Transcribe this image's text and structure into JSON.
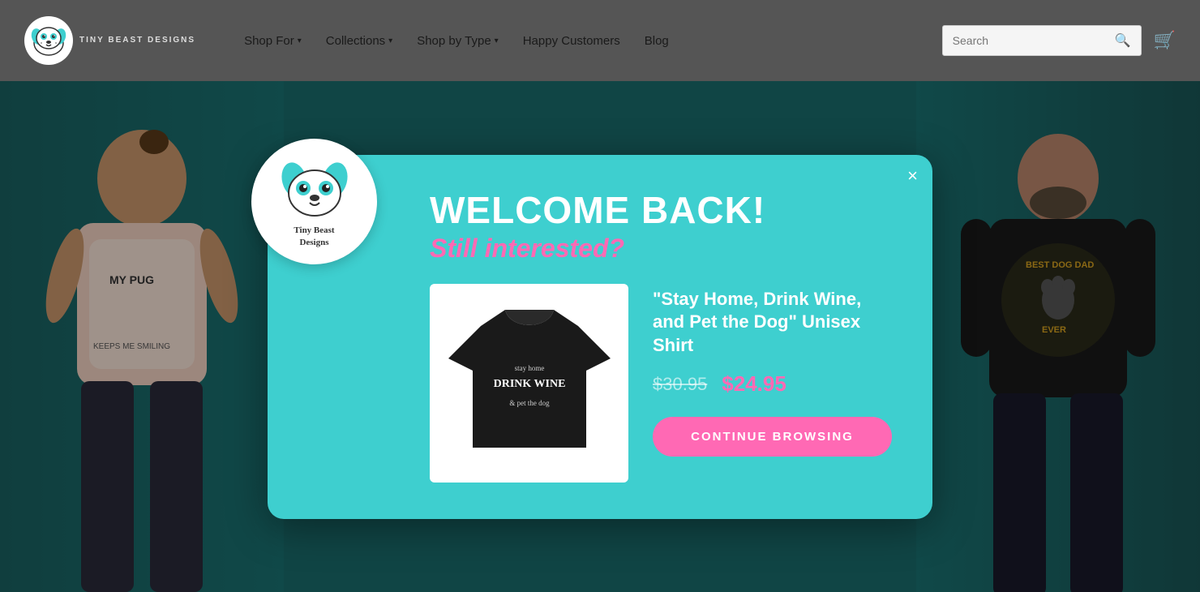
{
  "header": {
    "brand_name": "Tiny Beast Designs",
    "nav_items": [
      {
        "label": "Shop For",
        "has_dropdown": true
      },
      {
        "label": "Collections",
        "has_dropdown": true
      },
      {
        "label": "Shop by Type",
        "has_dropdown": true
      },
      {
        "label": "Happy Customers",
        "has_dropdown": false
      },
      {
        "label": "Blog",
        "has_dropdown": false
      }
    ],
    "search_placeholder": "Search",
    "cart_icon": "🛒",
    "search_icon": "🔍"
  },
  "modal": {
    "logo_brand_text": "Tiny Beast\nDesigns",
    "title": "WELCOME BACK!",
    "subtitle": "Still interested?",
    "close_label": "×",
    "product": {
      "name": "\"Stay Home, Drink Wine, and Pet the Dog\" Unisex Shirt",
      "original_price": "$30.95",
      "sale_price": "$24.95",
      "cta_label": "CONTINUE BROWSING"
    }
  },
  "colors": {
    "teal": "#3ecfcf",
    "pink": "#ff69b4",
    "dark_teal_bg": "#1a7070",
    "white": "#ffffff"
  }
}
